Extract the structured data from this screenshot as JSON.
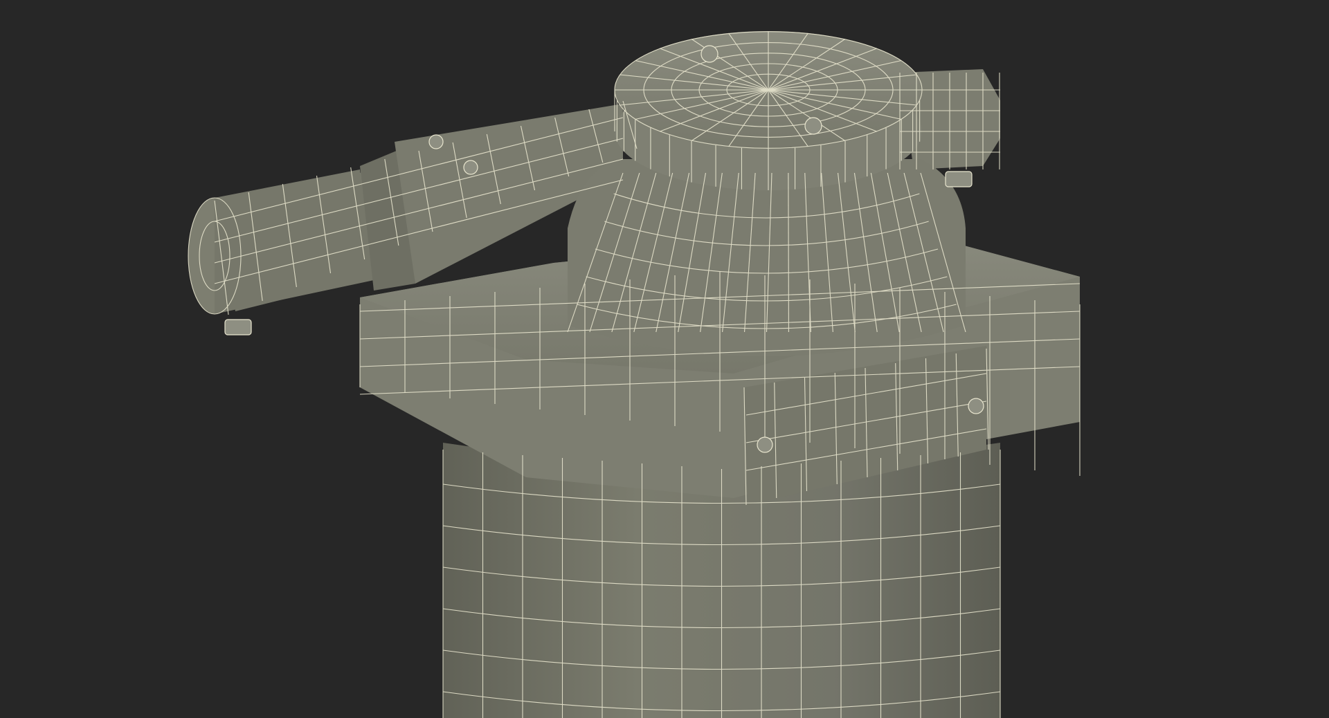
{
  "scene": {
    "description_visible_text": [],
    "background_color": "#272727",
    "mesh_fill_color": "#7a7b6d",
    "mesh_shadow_color": "#5f6056",
    "mesh_highlight_color": "#8d8e80",
    "wire_color": "#e9e6cf",
    "render_style": "wireframe-over-shaded"
  }
}
